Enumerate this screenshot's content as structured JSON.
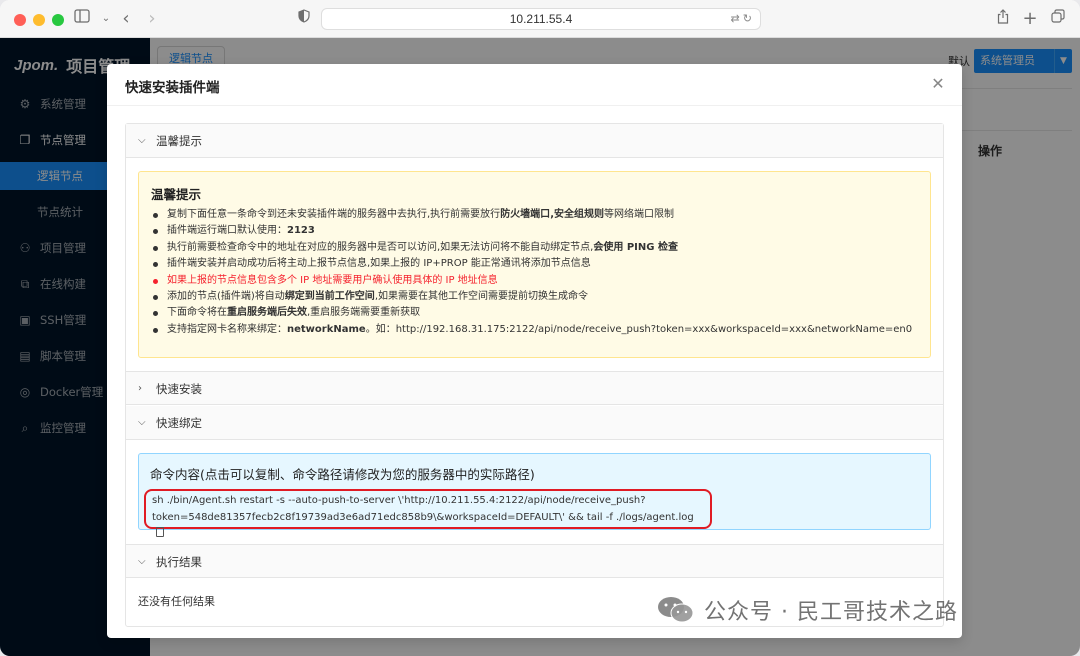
{
  "browser": {
    "url": "10.211.55.4"
  },
  "app": {
    "logo": "Jpom.",
    "title": "项目管理",
    "menu": [
      {
        "label": "系统管理",
        "icon": "gear-icon"
      },
      {
        "label": "节点管理",
        "icon": "copy-icon"
      },
      {
        "label": "逻辑节点",
        "sub": true,
        "active": true
      },
      {
        "label": "节点统计",
        "sub": true
      },
      {
        "label": "项目管理",
        "icon": "sitemap-icon"
      },
      {
        "label": "在线构建",
        "icon": "build-icon"
      },
      {
        "label": "SSH管理",
        "icon": "terminal-icon"
      },
      {
        "label": "脚本管理",
        "icon": "file-icon"
      },
      {
        "label": "Docker管理",
        "icon": "docker-icon"
      },
      {
        "label": "监控管理",
        "icon": "monitor-icon"
      }
    ],
    "tab_label": "逻辑节点",
    "default_label": "默认",
    "role": "系统管理员",
    "column_action": "操作"
  },
  "modal": {
    "title": "快速安装插件端",
    "panels": {
      "tips_header": "温馨提示",
      "install_header": "快速安装",
      "bind_header": "快速绑定",
      "result_header": "执行结果"
    },
    "tips": {
      "title": "温馨提示",
      "items": [
        {
          "parts": [
            "复制下面任意一条命令到还未安装插件端的服务器中去执行,执行前需要放行",
            "防火墙端口",
            ",",
            "安全组规则",
            "等网络端口限制"
          ]
        },
        {
          "parts": [
            "插件端运行端口默认使用：",
            "2123"
          ]
        },
        {
          "parts": [
            "执行前需要检查命令中的地址在对应的服务器中是否可以访问,如果无法访问将不能自动绑定节点,",
            "会使用 PING 检查"
          ]
        },
        {
          "parts": [
            "插件端安装并启动成功后将主动上报节点信息,如果上报的 IP+PROP 能正常通讯将添加节点信息"
          ]
        },
        {
          "parts": [
            "如果上报的节点信息包含多个 IP 地址需要用户确认使用具体的 IP 地址信息"
          ]
        },
        {
          "parts": [
            "添加的节点(插件端)将自动",
            "绑定到当前工作空间",
            ",如果需要在其他工作空间需要提前切换生成命令"
          ]
        },
        {
          "parts": [
            "下面命令将在",
            "重启服务端后失效",
            ",重启服务端需要重新获取"
          ]
        },
        {
          "parts": [
            "支持指定网卡名称来绑定：",
            "networkName",
            "。如：http://192.168.31.175:2122/api/node/receive_push?token=xxx&workspaceId=xxx&networkName=en0"
          ]
        }
      ]
    },
    "command": {
      "title": "命令内容(点击可以复制、命令路径请修改为您的服务器中的实际路径)",
      "line1": "sh ./bin/Agent.sh restart -s --auto-push-to-server \\'http://10.211.55.4:2122/api/node/receive_push?",
      "line2": "token=548de81357fecb2c8f19739ad3e6ad71edc858b9\\&workspaceId=DEFAULT\\' && tail -f ./logs/agent.log"
    },
    "result_empty": "还没有任何结果"
  },
  "watermark": "公众号 · 民工哥技术之路"
}
